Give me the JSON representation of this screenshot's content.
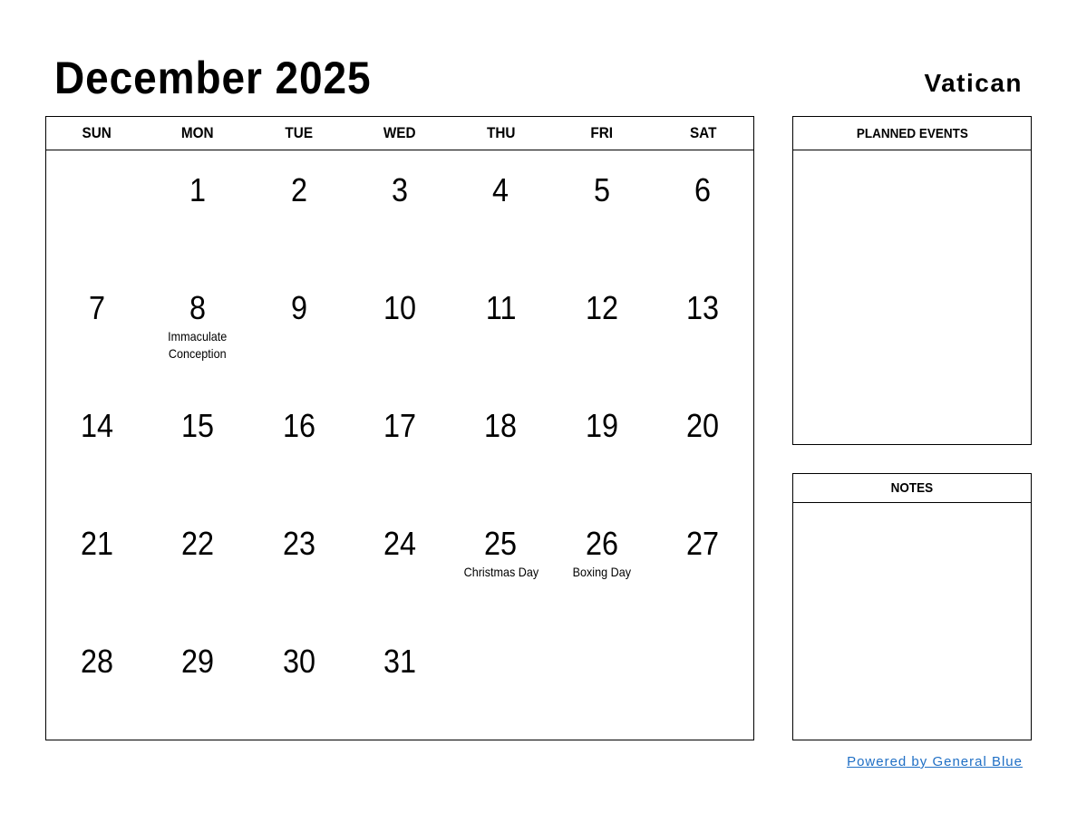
{
  "header": {
    "title": "December 2025",
    "country": "Vatican"
  },
  "calendar": {
    "weekdays": [
      "SUN",
      "MON",
      "TUE",
      "WED",
      "THU",
      "FRI",
      "SAT"
    ],
    "weeks": [
      [
        {
          "day": ""
        },
        {
          "day": "1"
        },
        {
          "day": "2"
        },
        {
          "day": "3"
        },
        {
          "day": "4"
        },
        {
          "day": "5"
        },
        {
          "day": "6"
        }
      ],
      [
        {
          "day": "7"
        },
        {
          "day": "8",
          "holiday": "Immaculate Conception"
        },
        {
          "day": "9"
        },
        {
          "day": "10"
        },
        {
          "day": "11"
        },
        {
          "day": "12"
        },
        {
          "day": "13"
        }
      ],
      [
        {
          "day": "14"
        },
        {
          "day": "15"
        },
        {
          "day": "16"
        },
        {
          "day": "17"
        },
        {
          "day": "18"
        },
        {
          "day": "19"
        },
        {
          "day": "20"
        }
      ],
      [
        {
          "day": "21"
        },
        {
          "day": "22"
        },
        {
          "day": "23"
        },
        {
          "day": "24"
        },
        {
          "day": "25",
          "holiday": "Christmas Day"
        },
        {
          "day": "26",
          "holiday": "Boxing Day"
        },
        {
          "day": "27"
        }
      ],
      [
        {
          "day": "28"
        },
        {
          "day": "29"
        },
        {
          "day": "30"
        },
        {
          "day": "31"
        },
        {
          "day": ""
        },
        {
          "day": ""
        },
        {
          "day": ""
        }
      ]
    ]
  },
  "sidebar": {
    "planned_events_label": "PLANNED EVENTS",
    "notes_label": "NOTES"
  },
  "footer": {
    "link_text": "Powered by General Blue",
    "link_color": "#1f6fc5"
  }
}
